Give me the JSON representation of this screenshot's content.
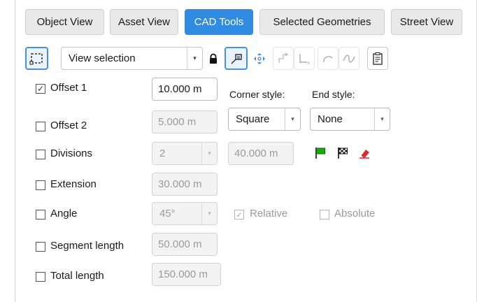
{
  "tabs": [
    {
      "label": "Object View",
      "active": false
    },
    {
      "label": "Asset View",
      "active": false
    },
    {
      "label": "CAD Tools",
      "active": true
    },
    {
      "label": "Selected Geometries",
      "active": false
    },
    {
      "label": "Street View",
      "active": false
    }
  ],
  "toolbar": {
    "selector_value": "View selection",
    "icons": [
      "selection-rect-icon",
      "dropdown-caret-icon",
      "lock-icon",
      "offset-line-icon",
      "move-arrows-icon",
      "transfer-icon",
      "axis-icon",
      "arc-icon",
      "curve-icon",
      "clipboard-icon"
    ]
  },
  "rows": {
    "offset1": {
      "label": "Offset 1",
      "checked": true,
      "value": "10.000 m"
    },
    "offset2": {
      "label": "Offset 2",
      "checked": false,
      "value": "5.000 m"
    },
    "divisions": {
      "label": "Divisions",
      "checked": false,
      "value": "2",
      "length": "40.000 m"
    },
    "extension": {
      "label": "Extension",
      "checked": false,
      "value": "30.000 m"
    },
    "angle": {
      "label": "Angle",
      "checked": false,
      "value": "45°",
      "relative": "Relative",
      "absolute": "Absolute"
    },
    "segment_length": {
      "label": "Segment length",
      "checked": false,
      "value": "50.000 m"
    },
    "total_length": {
      "label": "Total length",
      "checked": false,
      "value": "150.000 m"
    }
  },
  "corner_style": {
    "label": "Corner style:",
    "value": "Square"
  },
  "end_style": {
    "label": "End style:",
    "value": "None"
  },
  "colors": {
    "accent": "#2f8ce0",
    "start_flag": "#1aa80f",
    "eraser": "#e0262b"
  }
}
